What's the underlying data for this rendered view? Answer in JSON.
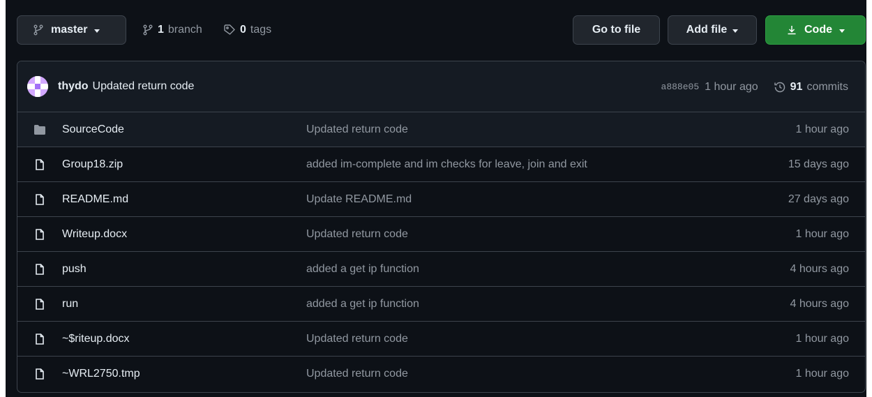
{
  "toolbar": {
    "branch_name": "master",
    "branches_count": "1",
    "branches_label": "branch",
    "tags_count": "0",
    "tags_label": "tags",
    "goto_label": "Go to file",
    "add_label": "Add file",
    "code_label": "Code"
  },
  "commit": {
    "author": "thydo",
    "message": "Updated return code",
    "sha": "a888e05",
    "time": "1 hour ago",
    "commits_count": "91",
    "commits_label": "commits"
  },
  "files": [
    {
      "name": "SourceCode",
      "type": "folder",
      "message": "Updated return code",
      "age": "1 hour ago"
    },
    {
      "name": "Group18.zip",
      "type": "file",
      "message": "added im-complete and im checks for leave, join and exit",
      "age": "15 days ago"
    },
    {
      "name": "README.md",
      "type": "file",
      "message": "Update README.md",
      "age": "27 days ago"
    },
    {
      "name": "Writeup.docx",
      "type": "file",
      "message": "Updated return code",
      "age": "1 hour ago"
    },
    {
      "name": "push",
      "type": "file",
      "message": "added a get ip function",
      "age": "4 hours ago"
    },
    {
      "name": "run",
      "type": "file",
      "message": "added a get ip function",
      "age": "4 hours ago"
    },
    {
      "name": "~$riteup.docx",
      "type": "file",
      "message": "Updated return code",
      "age": "1 hour ago"
    },
    {
      "name": "~WRL2750.tmp",
      "type": "file",
      "message": "Updated return code",
      "age": "1 hour ago"
    }
  ],
  "colors": {
    "background": "#0d1117",
    "accent_green": "#238636",
    "muted_text": "#9198a1",
    "border": "#3d444d"
  }
}
